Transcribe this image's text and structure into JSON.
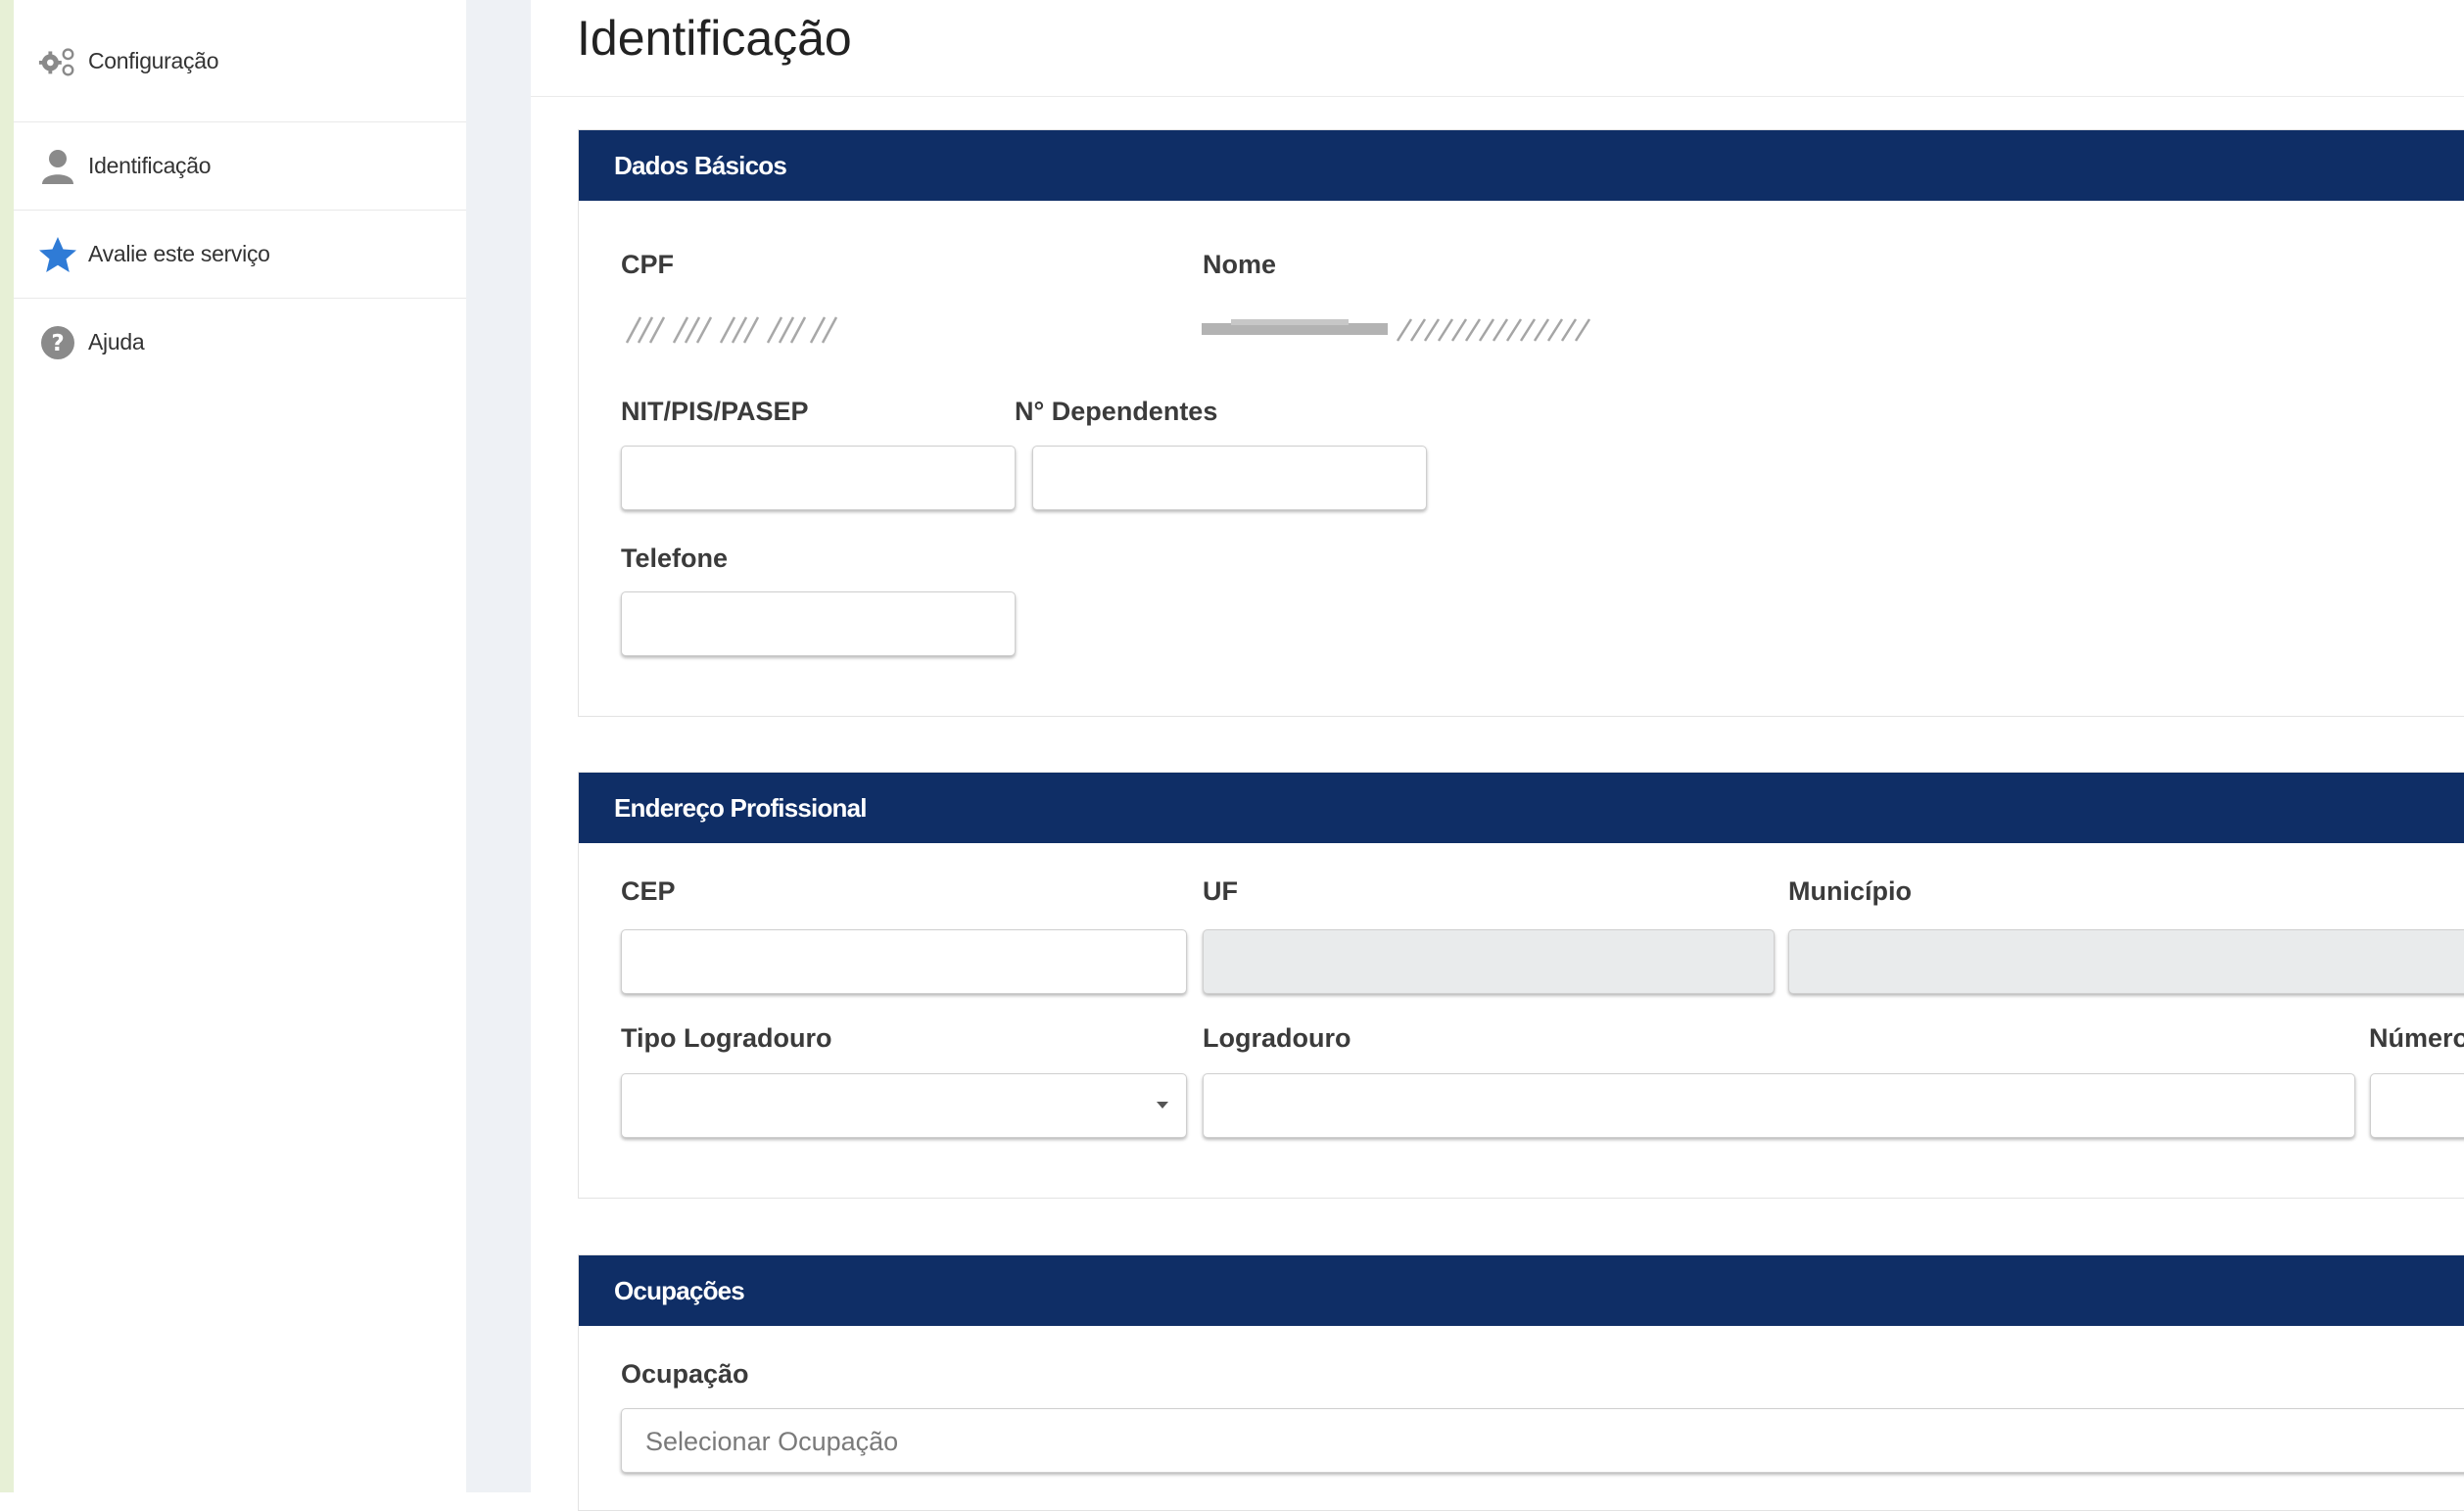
{
  "sidebar": {
    "items": [
      {
        "label": "Configuração",
        "icon": "gears-icon"
      },
      {
        "label": "Identificação",
        "icon": "user-icon"
      },
      {
        "label": "Avalie este serviço",
        "icon": "star-icon"
      },
      {
        "label": "Ajuda",
        "icon": "help-icon"
      }
    ]
  },
  "page": {
    "title": "Identificação"
  },
  "dados_basicos": {
    "title": "Dados Básicos",
    "cpf_label": "CPF",
    "nome_label": "Nome",
    "nit_label": "NIT/PIS/PASEP",
    "dependentes_label": "N° Dependentes",
    "telefone_label": "Telefone"
  },
  "endereco": {
    "title": "Endereço Profissional",
    "cep_label": "CEP",
    "uf_label": "UF",
    "municipio_label": "Município",
    "tipo_logradouro_label": "Tipo Logradouro",
    "logradouro_label": "Logradouro",
    "numero_label": "Número"
  },
  "ocupacoes": {
    "title": "Ocupações",
    "ocupacao_label": "Ocupação",
    "ocupacao_placeholder": "Selecionar Ocupação"
  },
  "colors": {
    "panel_header": "#0f2e66",
    "star": "#2f7bd6",
    "left_strip": "#e7f0d6"
  }
}
